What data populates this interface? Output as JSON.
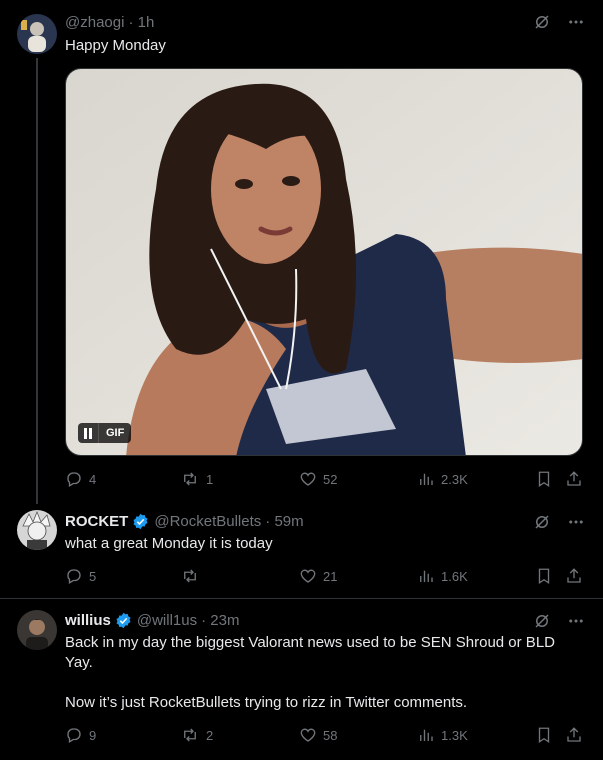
{
  "colors": {
    "background": "#000000",
    "text": "#e7e9ea",
    "muted": "#71767b",
    "verified": "#1d9bf0",
    "divider": "#2f3336"
  },
  "posts": [
    {
      "name": "",
      "handle": "@zhaogi",
      "time": "· 1h",
      "text": "Happy Monday",
      "gif_label": "GIF",
      "replies": "4",
      "reposts": "1",
      "likes": "52",
      "views": "2.3K"
    },
    {
      "name": "ROCKET",
      "handle": "@RocketBullets",
      "time": "· 59m",
      "text": "what a great Monday it is today",
      "replies": "5",
      "reposts": "",
      "likes": "21",
      "views": "1.6K"
    },
    {
      "name": "willius",
      "handle": "@will1us",
      "time": "· 23m",
      "text": "Back in my day the biggest Valorant news used to be SEN Shroud or BLD Yay.\n\nNow it’s just RocketBullets trying to rizz in Twitter comments.",
      "replies": "9",
      "reposts": "2",
      "likes": "58",
      "views": "1.3K"
    }
  ],
  "icons": {
    "grok": "grok-icon",
    "more": "more-icon",
    "reply": "reply-icon",
    "repost": "repost-icon",
    "like": "heart-icon",
    "views": "views-icon",
    "bookmark": "bookmark-icon",
    "share": "share-icon",
    "verified": "verified-badge-icon",
    "pause": "pause-icon"
  }
}
